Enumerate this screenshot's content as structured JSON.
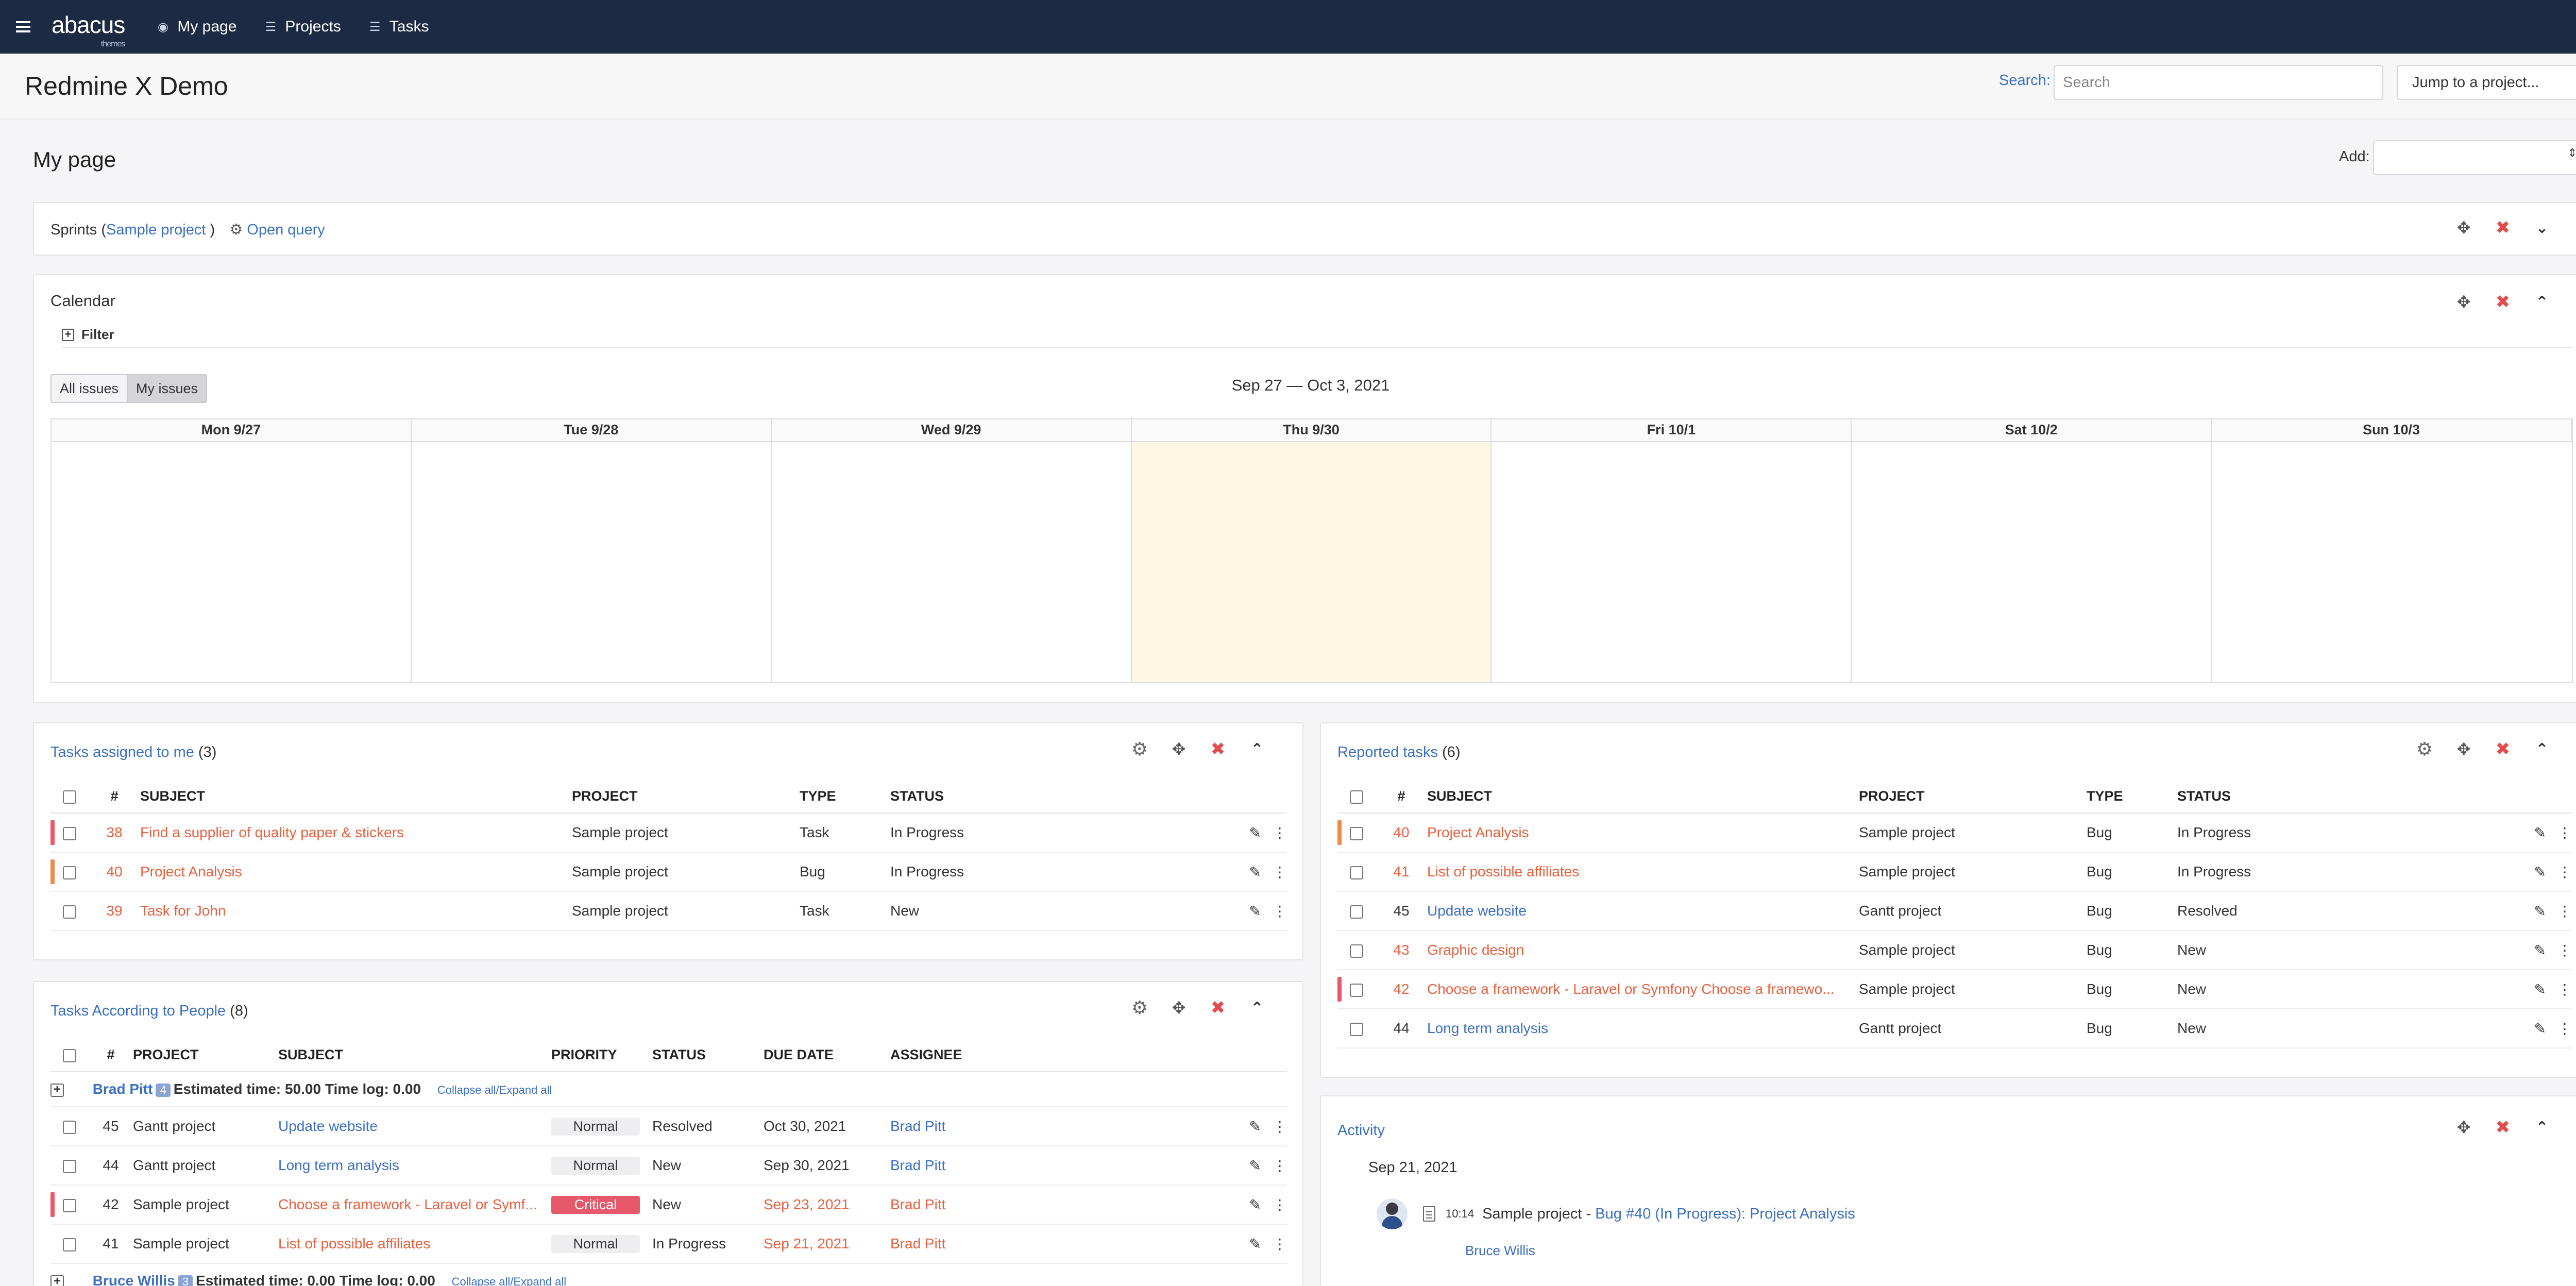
{
  "nav": {
    "logo": "abacus",
    "logo_sub": "themes",
    "items": [
      {
        "label": "My page",
        "icon": "dashboard-icon"
      },
      {
        "label": "Projects",
        "icon": "list-icon"
      },
      {
        "label": "Tasks",
        "icon": "list-icon"
      }
    ],
    "plus": "+"
  },
  "header": {
    "title": "Redmine X Demo",
    "search_label": "Search:",
    "search_placeholder": "Search",
    "jump_label": "Jump to a project...",
    "jump_caret": "⌄"
  },
  "page": {
    "title": "My page",
    "add_label": "Add:",
    "add_caret": "⇕"
  },
  "sprints": {
    "title_prefix": "Sprints (",
    "project": "Sample project",
    "title_suffix": " )",
    "open_query": "Open query"
  },
  "calendar": {
    "title": "Calendar",
    "filter": "Filter",
    "btn_all": "All issues",
    "btn_mine": "My issues",
    "range": "Sep 27 — Oct 3, 2021",
    "days": [
      "Mon 9/27",
      "Tue 9/28",
      "Wed 9/29",
      "Thu 9/30",
      "Fri 10/1",
      "Sat 10/2",
      "Sun 10/3"
    ]
  },
  "assigned": {
    "title": "Tasks assigned to me",
    "count": "(3)",
    "headers": {
      "num": "#",
      "subject": "SUBJECT",
      "project": "PROJECT",
      "type": "TYPE",
      "status": "STATUS"
    },
    "rows": [
      {
        "bar": "#e8586b",
        "num": "38",
        "subject": "Find a supplier of quality paper & stickers",
        "project": "Sample project",
        "type": "Task",
        "status": "In Progress",
        "overdue": true
      },
      {
        "bar": "#f08a4b",
        "num": "40",
        "subject": "Project Analysis",
        "project": "Sample project",
        "type": "Bug",
        "status": "In Progress",
        "overdue": true
      },
      {
        "bar": "",
        "num": "39",
        "subject": "Task for John",
        "project": "Sample project",
        "type": "Task",
        "status": "New",
        "overdue": true
      }
    ]
  },
  "reported": {
    "title": "Reported tasks",
    "count": "(6)",
    "headers": {
      "num": "#",
      "subject": "SUBJECT",
      "project": "PROJECT",
      "type": "TYPE",
      "status": "STATUS"
    },
    "rows": [
      {
        "bar": "#f08a4b",
        "num": "40",
        "subject": "Project Analysis",
        "project": "Sample project",
        "type": "Bug",
        "status": "In Progress",
        "overdue": true
      },
      {
        "bar": "",
        "num": "41",
        "subject": "List of possible affiliates",
        "project": "Sample project",
        "type": "Bug",
        "status": "In Progress",
        "overdue": true
      },
      {
        "bar": "",
        "num": "45",
        "subject": "Update website",
        "project": "Gantt project",
        "type": "Bug",
        "status": "Resolved",
        "overdue": false
      },
      {
        "bar": "",
        "num": "43",
        "subject": "Graphic design",
        "project": "Sample project",
        "type": "Bug",
        "status": "New",
        "overdue": true
      },
      {
        "bar": "#e8586b",
        "num": "42",
        "subject": "Choose a framework - Laravel or Symfony Choose a framewo...",
        "project": "Sample project",
        "type": "Bug",
        "status": "New",
        "overdue": true
      },
      {
        "bar": "",
        "num": "44",
        "subject": "Long term analysis",
        "project": "Gantt project",
        "type": "Bug",
        "status": "New",
        "overdue": false
      }
    ]
  },
  "people": {
    "title": "Tasks According to People",
    "count": "(8)",
    "headers": {
      "num": "#",
      "project": "PROJECT",
      "subject": "SUBJECT",
      "priority": "PRIORITY",
      "status": "STATUS",
      "due": "DUE DATE",
      "assignee": "ASSIGNEE"
    },
    "group1": {
      "name": "Brad Pitt",
      "count": "4",
      "summary": "Estimated time: 50.00 Time log: 0.00",
      "toggle": "Collapse all/Expand all"
    },
    "rows": [
      {
        "bar": "",
        "num": "45",
        "project": "Gantt project",
        "subject": "Update website",
        "priority": "Normal",
        "critical": false,
        "status": "Resolved",
        "due": "Oct 30, 2021",
        "due_overdue": false,
        "assignee": "Brad Pitt",
        "overdue": false
      },
      {
        "bar": "",
        "num": "44",
        "project": "Gantt project",
        "subject": "Long term analysis",
        "priority": "Normal",
        "critical": false,
        "status": "New",
        "due": "Sep 30, 2021",
        "due_overdue": false,
        "assignee": "Brad Pitt",
        "overdue": false
      },
      {
        "bar": "#e8586b",
        "num": "42",
        "project": "Sample project",
        "subject": "Choose a framework - Laravel or Symf...",
        "priority": "Critical",
        "critical": true,
        "status": "New",
        "due": "Sep 23, 2021",
        "due_overdue": true,
        "assignee": "Brad Pitt",
        "overdue": true
      },
      {
        "bar": "",
        "num": "41",
        "project": "Sample project",
        "subject": "List of possible affiliates",
        "priority": "Normal",
        "critical": false,
        "status": "In Progress",
        "due": "Sep 21, 2021",
        "due_overdue": true,
        "assignee": "Brad Pitt",
        "overdue": true
      }
    ],
    "group2": {
      "name": "Bruce Willis",
      "count": "3",
      "summary": "Estimated time: 0.00 Time log: 0.00",
      "toggle": "Collapse all/Expand all"
    }
  },
  "activity": {
    "title": "Activity",
    "date": "Sep 21, 2021",
    "time": "10:14",
    "project": "Sample project",
    "separator": " - ",
    "link": "Bug #40 (In Progress): Project Analysis",
    "author": "Bruce Willis"
  },
  "icons": {
    "move": "✥",
    "close": "✖",
    "chevron_down": "⌄",
    "chevron_up": "⌃",
    "gear": "⚙",
    "edit": "✎",
    "more": "⋮"
  }
}
